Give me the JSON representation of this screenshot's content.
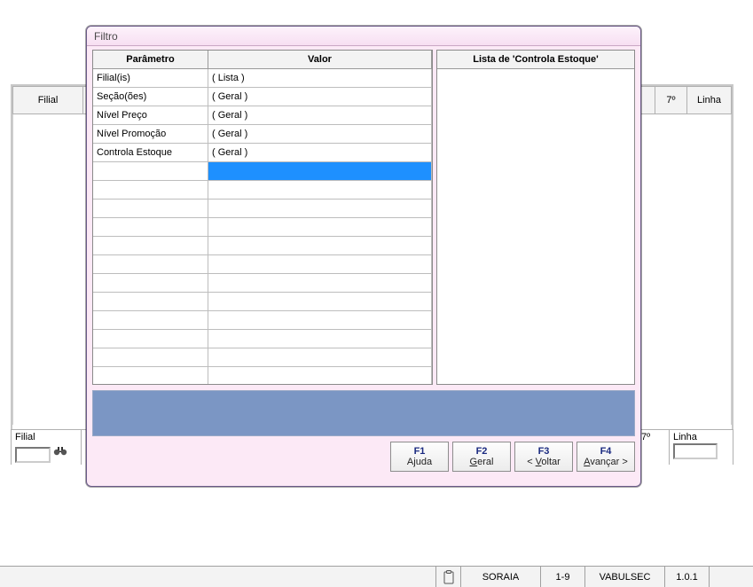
{
  "bg": {
    "headers": {
      "filial": "Filial",
      "seventh": "7º",
      "linha": "Linha"
    },
    "filter": {
      "filial_label": "Filial",
      "filial_value": "",
      "seventh_label": "7º",
      "seventh_value": "",
      "linha_label": "Linha",
      "linha_value": ""
    }
  },
  "dialog": {
    "title": "Filtro",
    "headers": {
      "parametro": "Parâmetro",
      "valor": "Valor"
    },
    "rows": [
      {
        "param": "Filial(is)",
        "valor": "( Lista )"
      },
      {
        "param": "Seção(ões)",
        "valor": "( Geral )"
      },
      {
        "param": "Nível Preço",
        "valor": "( Geral )"
      },
      {
        "param": "Nível Promoção",
        "valor": "( Geral )"
      },
      {
        "param": "Controla Estoque",
        "valor": "( Geral )"
      },
      {
        "param": "",
        "valor": "",
        "selected": true
      },
      {
        "param": "",
        "valor": ""
      },
      {
        "param": "",
        "valor": ""
      },
      {
        "param": "",
        "valor": ""
      },
      {
        "param": "",
        "valor": ""
      },
      {
        "param": "",
        "valor": ""
      },
      {
        "param": "",
        "valor": ""
      },
      {
        "param": "",
        "valor": ""
      },
      {
        "param": "",
        "valor": ""
      },
      {
        "param": "",
        "valor": ""
      },
      {
        "param": "",
        "valor": ""
      },
      {
        "param": "",
        "valor": ""
      }
    ],
    "lista_title": "Lista de 'Controla Estoque'",
    "fkeys": [
      {
        "key": "F1",
        "label": "Ajuda",
        "u": ""
      },
      {
        "key": "F2",
        "label": "Geral",
        "u": "G"
      },
      {
        "key": "F3",
        "label": "< Voltar",
        "u": "V"
      },
      {
        "key": "F4",
        "label": "Avançar >",
        "u": "A"
      }
    ]
  },
  "status": {
    "user": "SORAIA",
    "range": "1-9",
    "module": "VABULSEC",
    "version": "1.0.1"
  },
  "icons": {
    "binoculars": "binoculars-icon",
    "clipboard": "clipboard-icon"
  }
}
